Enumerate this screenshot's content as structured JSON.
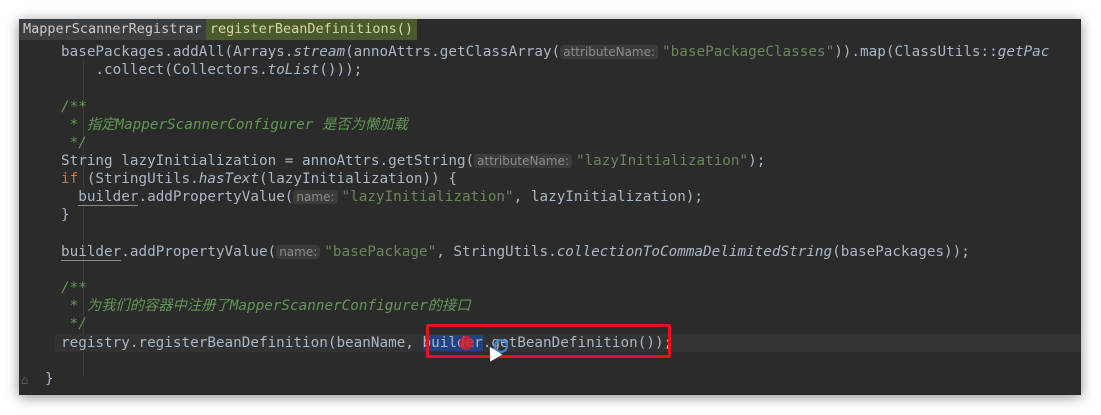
{
  "breadcrumb": {
    "class_name": "MapperScannerRegistrar",
    "method_name": "registerBeanDefinitions()"
  },
  "code": {
    "l1": {
      "a": "basePackages.addAll(Arrays.",
      "b": "stream",
      "c": "(annoAttrs.getClassArray(",
      "hint": "attributeName:",
      "str": "\"basePackageClasses\"",
      "d": ")).map(ClassUtils::",
      "e": "getPac"
    },
    "l2": {
      "a": "    .collect(Collectors.",
      "b": "toList",
      "c": "()));"
    },
    "l4": "/**",
    "l5": " * 指定MapperScannerConfigurer 是否为懒加载",
    "l6": " */",
    "l7": {
      "a": "String lazyInitialization = annoAttrs.getString(",
      "hint": "attributeName:",
      "str": "\"lazyInitialization\"",
      "b": ");"
    },
    "l8": {
      "kw": "if",
      "a": " (StringUtils.",
      "b": "hasText",
      "c": "(lazyInitialization)) {"
    },
    "l9": {
      "ind": "  ",
      "fld": "builder",
      "a": ".addPropertyValue(",
      "hint": "name:",
      "str": "\"lazyInitialization\"",
      "b": ", lazyInitialization);"
    },
    "l10": "}",
    "l12": {
      "fld": "builder",
      "a": ".addPropertyValue(",
      "hint": "name:",
      "str": "\"basePackage\"",
      "b": ", StringUtils.",
      "c": "collectionToCommaDelimitedString",
      "d": "(basePackages));"
    },
    "l14": "/**",
    "l15": " * 为我们的容器中注册了MapperScannerConfigurer的接口",
    "l16": " */",
    "l17": {
      "a": "registry.registerBeanDefinition(beanName, ",
      "sel": "builder",
      "b": ".getBeanDefinition()",
      "c": ");"
    },
    "l19": "}"
  }
}
